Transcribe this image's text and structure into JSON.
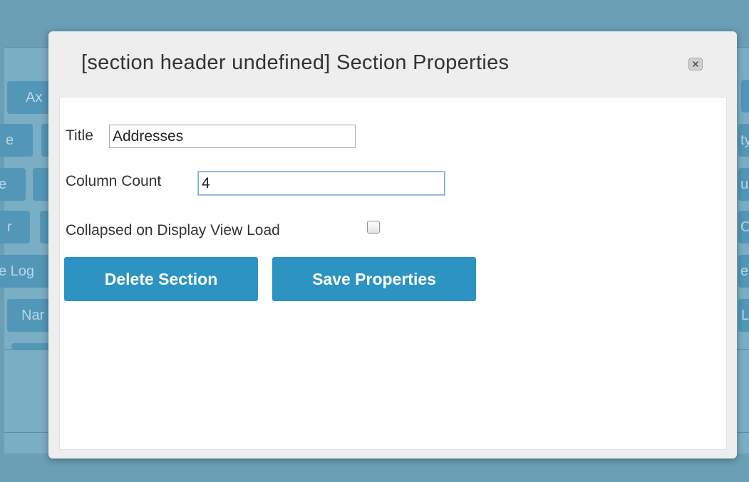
{
  "background": {
    "chips": [
      {
        "text": "Ax"
      },
      {
        "text": "e"
      },
      {
        "text": "e"
      },
      {
        "text": "r"
      },
      {
        "text": "e Log"
      },
      {
        "text": "Nar"
      },
      {
        "text": "ty"
      },
      {
        "text": "ue"
      },
      {
        "text": "O"
      },
      {
        "text": "er"
      },
      {
        "text": "L"
      }
    ]
  },
  "modal": {
    "title": "[section header undefined] Section Properties",
    "close_icon": "close-icon",
    "fields": {
      "title_label": "Title",
      "title_value": "Addresses",
      "column_count_label": "Column Count",
      "column_count_value": "4",
      "collapsed_label": "Collapsed on Display View Load",
      "collapsed_checked": false
    },
    "buttons": {
      "delete_label": "Delete Section",
      "save_label": "Save Properties"
    }
  },
  "colors": {
    "backdrop": "#6a9fb6",
    "button": "#2c93c2",
    "modal_header": "#eeeeee"
  }
}
